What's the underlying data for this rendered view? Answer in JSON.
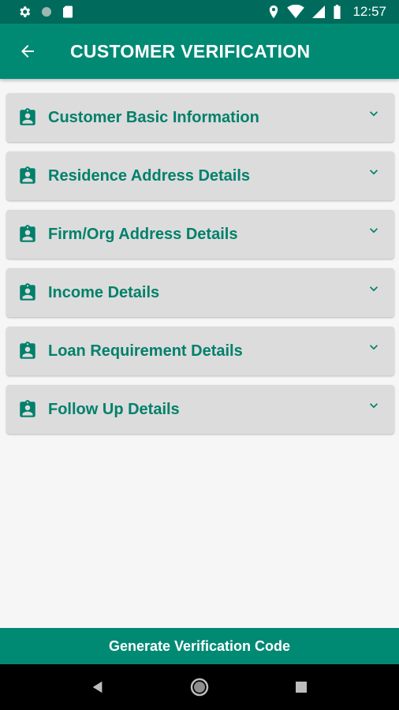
{
  "status_bar": {
    "time": "12:57",
    "left_icons": [
      "gear-icon",
      "circle-icon",
      "sd-card-icon"
    ],
    "right_icons": [
      "location-icon",
      "wifi-icon",
      "signal-icon",
      "battery-icon"
    ]
  },
  "app_bar": {
    "back_icon": "arrow-left-icon",
    "title": "CUSTOMER VERIFICATION"
  },
  "sections": [
    {
      "label": "Customer Basic Information",
      "icon": "badge-icon"
    },
    {
      "label": "Residence Address Details",
      "icon": "badge-icon"
    },
    {
      "label": "Firm/Org Address Details",
      "icon": "badge-icon"
    },
    {
      "label": "Income Details",
      "icon": "badge-icon"
    },
    {
      "label": "Loan Requirement Details",
      "icon": "badge-icon"
    },
    {
      "label": "Follow Up Details",
      "icon": "badge-icon"
    }
  ],
  "footer": {
    "button_label": "Generate Verification Code"
  },
  "colors": {
    "status_bar": "#006b5c",
    "primary": "#008a74",
    "section_bg": "#dcdcdc",
    "section_text": "#00806b"
  }
}
